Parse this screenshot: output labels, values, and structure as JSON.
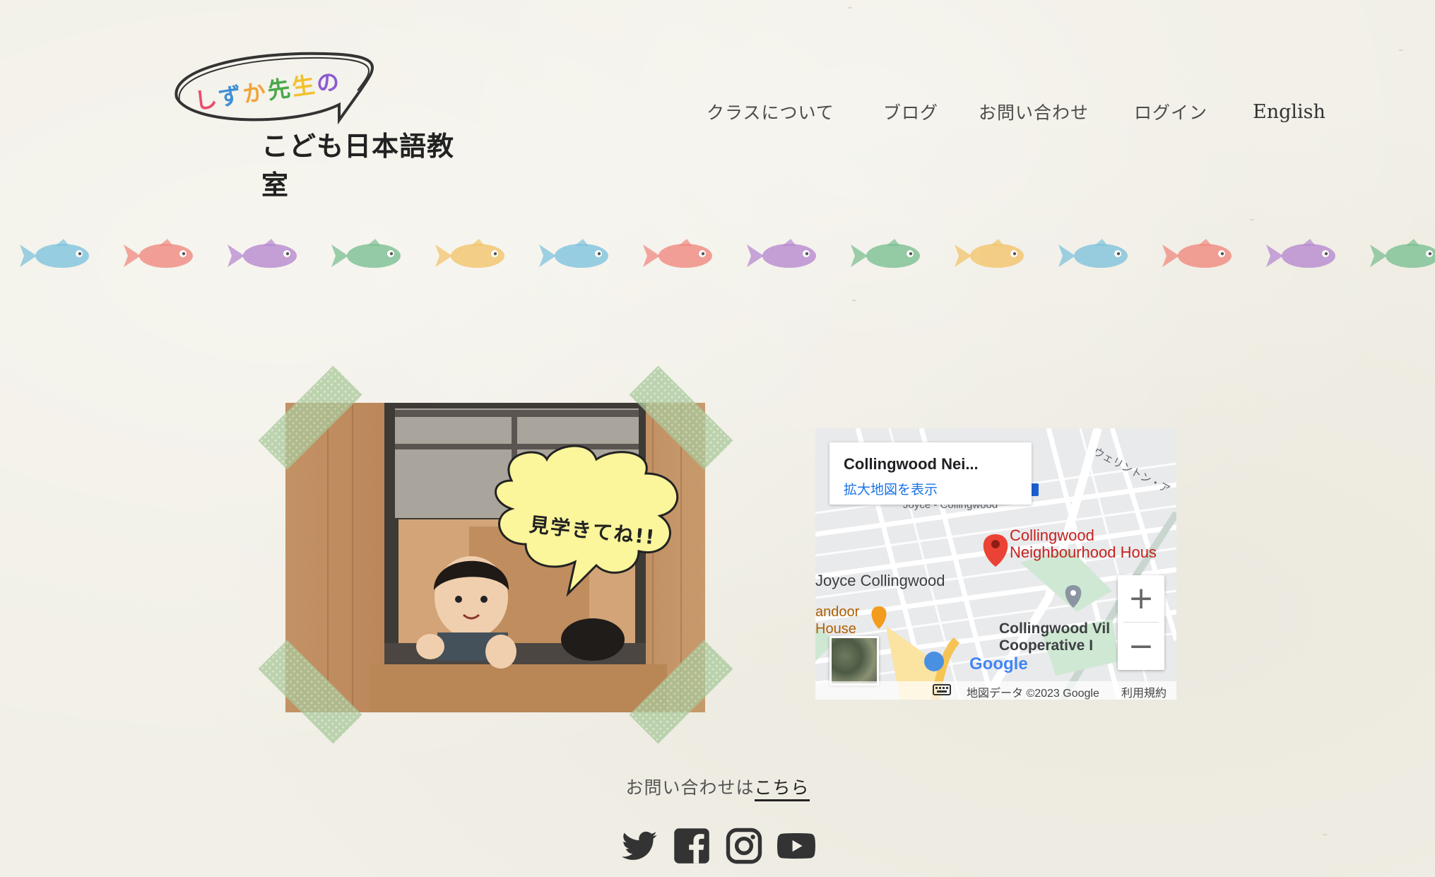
{
  "logo": {
    "line1": "しずか先生の",
    "line2": "こども日本語教室"
  },
  "nav": {
    "items": [
      {
        "label": "クラスについて"
      },
      {
        "label": "ブログ"
      },
      {
        "label": "お問い合わせ"
      },
      {
        "label": "ログイン"
      },
      {
        "label": "English"
      }
    ]
  },
  "photo": {
    "speech_bubble": "見学きてね!!"
  },
  "map": {
    "place_name": "Collingwood Nei...",
    "view_larger_link": "拡大地図を表示",
    "labels": {
      "marker_line1": "Collingwood",
      "marker_line2": "Neighbourhood Hous",
      "joyce": "Joyce Collingwood",
      "joyce_station": "Joyce - Collingwood",
      "tandoor1": "andoor",
      "tandoor2": "House",
      "village1": "Collingwood Vil",
      "village2": "Cooperative I",
      "street": "ウェリントン・ア",
      "brand": "Google"
    },
    "zoom_in": "+",
    "zoom_out": "−",
    "footer": {
      "data": "地図データ ©2023 Google",
      "terms": "利用規約"
    }
  },
  "contact": {
    "prefix": "お問い合わせは",
    "link": "こちら"
  },
  "social": [
    {
      "icon": "twitter-icon"
    },
    {
      "icon": "facebook-icon"
    },
    {
      "icon": "instagram-icon"
    },
    {
      "icon": "youtube-icon"
    }
  ],
  "colors": {
    "background": "#f1efe6",
    "tape": "#a9c99a",
    "bubble": "#fbf59b",
    "map_marker": "#ea4335",
    "map_link": "#1a73e8"
  }
}
